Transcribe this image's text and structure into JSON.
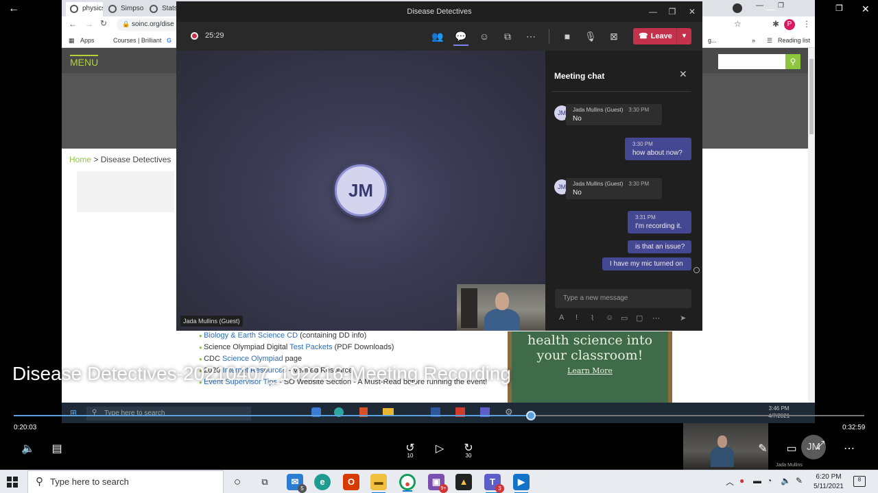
{
  "browser": {
    "tabs": [
      {
        "label": "physics"
      },
      {
        "label": "Simpso"
      },
      {
        "label": "Stats"
      }
    ],
    "url": "soinc.org/dise",
    "bookmarks": [
      "Apps",
      "Courses | Brilliant",
      "G"
    ],
    "reading_list": "Reading list",
    "profile_letter": "P",
    "overflow_text": "g..."
  },
  "site": {
    "menu": "MENU",
    "breadcrumb_home": "Home",
    "breadcrumb_sep": " > ",
    "breadcrumb_current": "Disease Detectives",
    "resources": [
      {
        "link": "Biology & Earth Science CD",
        "text": " (containing DD info)",
        "pre": ""
      },
      {
        "pre": "Science Olympiad Digital ",
        "link": "Test Packets",
        "text": " (PDF Downloads)"
      },
      {
        "pre": "CDC ",
        "link": "Science Olympiad",
        "text": " page"
      },
      {
        "pre": "2020 ",
        "link": "Internet Resources",
        "text": " - Verified Resource"
      },
      {
        "pre": "",
        "link": "Event Supervisor Tips",
        "text": " - SO Website Section - A Must-Read before running the event!"
      }
    ],
    "ad_line1": "health science into",
    "ad_line2": "your classroom!",
    "ad_cta": "Learn More"
  },
  "inner_taskbar": {
    "search_placeholder": "Type here to search",
    "time": "3:46 PM",
    "date": "4/7/2021"
  },
  "teams": {
    "window_title": "Disease Detectives",
    "recording_time": "25:29",
    "leave_label": "Leave",
    "participant_initials": "JM",
    "participant_name": "Jada Mullins (Guest)",
    "chat": {
      "title": "Meeting chat",
      "messages": [
        {
          "direction": "in",
          "author": "Jada Mullins (Guest)",
          "time": "3:30 PM",
          "text": "No"
        },
        {
          "direction": "out",
          "time": "3:30 PM",
          "text": "how about now?"
        },
        {
          "direction": "in",
          "author": "Jada Mullins (Guest)",
          "time": "3:30 PM",
          "text": "No"
        },
        {
          "direction": "out",
          "time": "3:31 PM",
          "text": "I'm recording it."
        },
        {
          "direction": "out",
          "text": "is that an issue?"
        },
        {
          "direction": "out",
          "text": "I have my mic turned on"
        }
      ],
      "compose_placeholder": "Type a new message"
    }
  },
  "player": {
    "video_title": "Disease Detectives-20210407_192216-Meeting Recording",
    "current_time": "0:20:03",
    "total_time": "0:32:59",
    "progress_fraction": 0.6077,
    "skip_back": "10",
    "skip_forward": "30",
    "thumbnail_caption": "Jada Mullins",
    "overlay_initials": "JM"
  },
  "taskbar": {
    "search_placeholder": "Type here to search",
    "mail_badge": "5",
    "teams_badge": "3",
    "extra_badge": "9+",
    "time": "6:20 PM",
    "date": "5/11/2021",
    "notification_count": "8"
  }
}
